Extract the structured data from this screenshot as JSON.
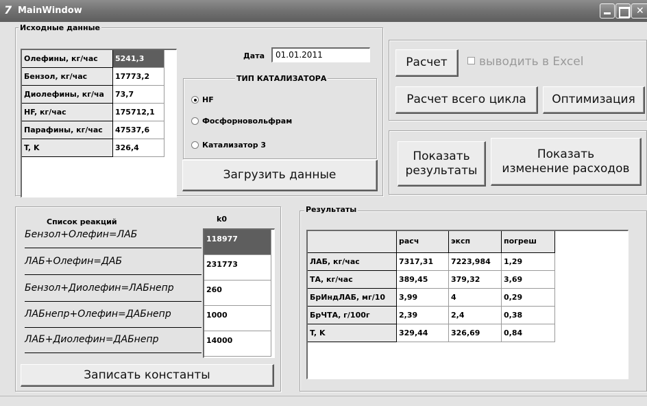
{
  "window": {
    "title": "MainWindow",
    "icon": "qt-app-icon"
  },
  "input_data": {
    "caption": "Исходные данные",
    "rows": [
      {
        "label": "Олефины, кг/час",
        "value": "5241,3"
      },
      {
        "label": "Бензол, кг/час",
        "value": "17773,2"
      },
      {
        "label": "Диолефины, кг/ча",
        "value": "73,7"
      },
      {
        "label": "HF, кг/час",
        "value": "175712,1"
      },
      {
        "label": "Парафины, кг/час",
        "value": "47537,6"
      },
      {
        "label": "T, K",
        "value": "326,4"
      }
    ]
  },
  "date": {
    "label": "Дата",
    "value": "01.01.2011"
  },
  "catalyst": {
    "caption": "ТИП КАТАЛИЗАТОРА",
    "options": [
      "HF",
      "Фосфорновольфрам",
      "Катализатор 3"
    ],
    "selected": "HF"
  },
  "load_button": "Загрузить данные",
  "calc": {
    "calc_button": "Расчет",
    "excel_checkbox": "выводить в Excel",
    "excel_checked": false,
    "full_cycle_button": "Расчет всего цикла",
    "optimize_button": "Оптимизация"
  },
  "show": {
    "results_button_line1": "Показать",
    "results_button_line2": "результаты",
    "changes_button_line1": "Показать",
    "changes_button_line2": "изменение расходов"
  },
  "reactions": {
    "list_header": "Список реакций",
    "k0_header": "k0",
    "rows": [
      {
        "reaction": "Бензол+Олефин=ЛАБ",
        "k0": "118977"
      },
      {
        "reaction": "ЛАБ+Олефин=ДАБ",
        "k0": "231773"
      },
      {
        "reaction": "Бензол+Диолефин=ЛАБнепр",
        "k0": "260"
      },
      {
        "reaction": "ЛАБнепр+Олефин=ДАБнепр",
        "k0": "1000"
      },
      {
        "reaction": "ЛАБ+Диолефин=ДАБнепр",
        "k0": "14000"
      }
    ],
    "save_button": "Записать константы"
  },
  "results": {
    "caption": "Результаты",
    "columns": [
      "",
      "расч",
      "эксп",
      "погреш"
    ],
    "rows": [
      [
        "ЛАБ, кг/час",
        "7317,31",
        "7223,984",
        "1,29"
      ],
      [
        "ТА, кг/час",
        "389,45",
        "379,32",
        "3,69"
      ],
      [
        "БрИндЛАБ, мг/10",
        "3,99",
        "4",
        "0,29"
      ],
      [
        "БрЧТА, г/100г",
        "2,39",
        "2,4",
        "0,38"
      ],
      [
        "T, K",
        "329,44",
        "326,69",
        "0,84"
      ]
    ]
  }
}
